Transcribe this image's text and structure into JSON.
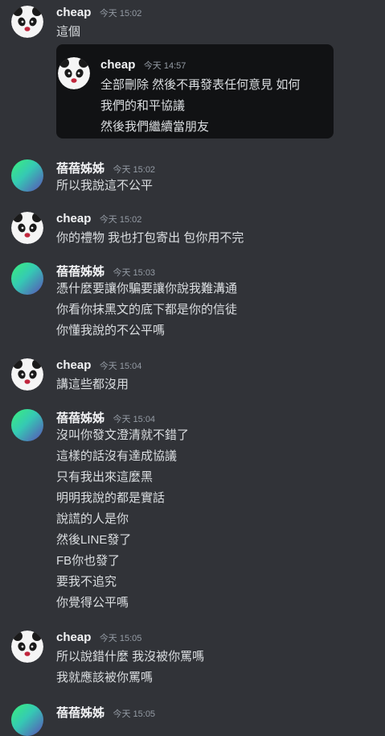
{
  "messages": [
    {
      "author": "cheap",
      "time": "今天 15:02",
      "lines": [
        "這個"
      ]
    },
    {
      "author": "cheap",
      "time": "今天 14:57",
      "lines": [
        "全部刪除 然後不再發表任何意見 如何",
        "我們的和平協議",
        "然後我們繼續當朋友"
      ]
    },
    {
      "author": "蓓蓓姊姊",
      "time": "今天 15:02",
      "lines": [
        "所以我說這不公平"
      ]
    },
    {
      "author": "cheap",
      "time": "今天 15:02",
      "lines": [
        "你的禮物 我也打包寄出 包你用不完"
      ]
    },
    {
      "author": "蓓蓓姊姊",
      "time": "今天 15:03",
      "lines": [
        "憑什麼要讓你騙要讓你說我難溝通",
        "你看你抹黑文的底下都是你的信徒",
        "你懂我說的不公平嗎"
      ]
    },
    {
      "author": "cheap",
      "time": "今天 15:04",
      "lines": [
        "講這些都沒用"
      ]
    },
    {
      "author": "蓓蓓姊姊",
      "time": "今天 15:04",
      "lines": [
        "沒叫你發文澄清就不錯了",
        "這樣的話沒有達成協議",
        "只有我出來這麼黑",
        "明明我說的都是實話",
        "說謊的人是你",
        "然後LINE發了",
        "FB你也發了",
        "要我不追究",
        "你覺得公平嗎"
      ]
    },
    {
      "author": "cheap",
      "time": "今天 15:05",
      "lines": [
        "所以說錯什麼 我沒被你罵嗎",
        "我就應該被你罵嗎"
      ]
    },
    {
      "author": "蓓蓓姊姊",
      "time": "今天 15:05",
      "lines": []
    }
  ]
}
